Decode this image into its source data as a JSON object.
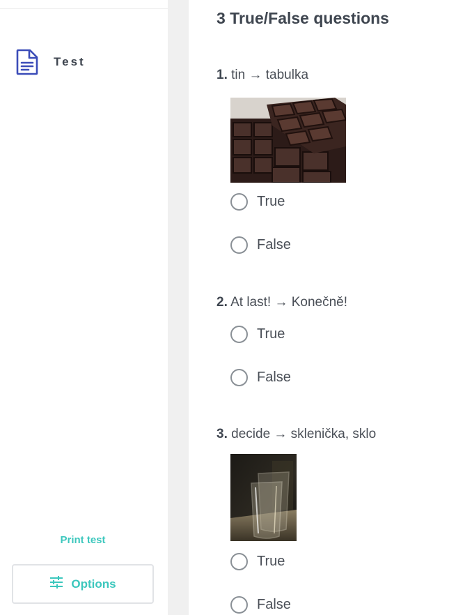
{
  "sidebar": {
    "nav_label": "Test",
    "print_label": "Print test",
    "options_label": "Options"
  },
  "section": {
    "title": "3 True/False questions"
  },
  "questions": [
    {
      "number": "1.",
      "text": "tin → tabulka",
      "image": "chocolate-bar-photo",
      "options": [
        "True",
        "False"
      ]
    },
    {
      "number": "2.",
      "text": "At last! → Konečně!",
      "options": [
        "True",
        "False"
      ]
    },
    {
      "number": "3.",
      "text": "decide → sklenička, sklo",
      "image": "drinking-glasses-photo",
      "options": [
        "True",
        "False"
      ]
    }
  ],
  "colors": {
    "accent": "#3cc7bd",
    "nav_icon": "#3b4cb8",
    "text": "#4a4f57",
    "gutter": "#f0f0f0"
  }
}
